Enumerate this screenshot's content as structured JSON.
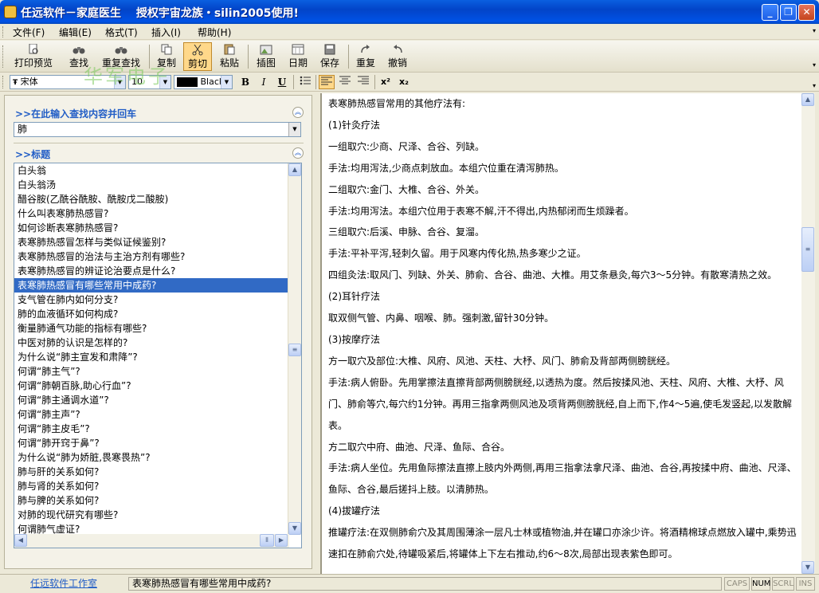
{
  "window": {
    "title": "任远软件－家庭医生　 授权宇宙龙族・silin2005使用!"
  },
  "menu": [
    "文件(F)",
    "编辑(E)",
    "格式(T)",
    "插入(I)",
    "帮助(H)"
  ],
  "toolbar": {
    "print_preview": "打印预览",
    "find": "查找",
    "find_again": "重复查找",
    "copy": "复制",
    "cut": "剪切",
    "paste": "粘贴",
    "insert_image": "插图",
    "date": "日期",
    "save": "保存",
    "redo": "重复",
    "undo": "撤销"
  },
  "format": {
    "font": "宋体",
    "size": "10",
    "color_name": "Black",
    "color_value": "#000000",
    "bold": "B",
    "italic": "I",
    "underline": "U",
    "superscript": "x²",
    "subscript": "x₂"
  },
  "watermark": "华军电子",
  "search": {
    "heading": ">>在此输入查找内容并回车",
    "value": "肺"
  },
  "titles": {
    "heading": ">>标题",
    "selected_index": 8,
    "items": [
      "白头翁",
      "白头翁汤",
      "醋谷胺(乙酰谷酰胺、酰胺戊二酸胺)",
      "什么叫表寒肺热感冒?",
      "如何诊断表寒肺热感冒?",
      "表寒肺热感冒怎样与类似证候鉴别?",
      "表寒肺热感冒的治法与主治方剂有哪些?",
      "表寒肺热感冒的辨证论治要点是什么?",
      "表寒肺热感冒有哪些常用中成药?",
      "支气管在肺内如何分支?",
      "肺的血液循环如何构成?",
      "衡量肺通气功能的指标有哪些?",
      "中医对肺的认识是怎样的?",
      "为什么说“肺主宣发和肃降”?",
      "何谓“肺主气”?",
      "何谓“肺朝百脉,助心行血”?",
      "何谓“肺主通调水道”?",
      "何谓“肺主声”?",
      "何谓“肺主皮毛”?",
      "何谓“肺开窍于鼻”?",
      "为什么说“肺为娇脏,畏寒畏热”?",
      "肺与肝的关系如何?",
      "肺与肾的关系如何?",
      "肺与脾的关系如何?",
      "对肺的现代研究有哪些?",
      "何谓肺气虚证?"
    ]
  },
  "content": [
    "表寒肺热感冒常用的其他疗法有:",
    "(1)针灸疗法",
    "一组取穴:少商、尺泽、合谷、列缺。",
    "手法:均用泻法,少商点刺放血。本组穴位重在清泻肺热。",
    "二组取穴:金门、大椎、合谷、外关。",
    "手法:均用泻法。本组穴位用于表寒不解,汗不得出,内热郁闭而生烦躁者。",
    "三组取穴:后溪、申脉、合谷、复溜。",
    "手法:平补平泻,轻刺久留。用于风寒内传化热,热多寒少之证。",
    "四组灸法:取风门、列缺、外关、肺俞、合谷、曲池、大椎。用艾条悬灸,每穴3～5分钟。有散寒清热之效。",
    "(2)耳针疗法",
    "取双侧气管、内鼻、咽喉、肺。强刺激,留针30分钟。",
    "(3)按摩疗法",
    "方一取穴及部位:大椎、风府、风池、天柱、大杼、风门、肺俞及背部两侧膀胱经。",
    "手法:病人俯卧。先用掌擦法直擦背部两侧膀胱经,以透热为度。然后按揉风池、天柱、风府、大椎、大杼、风门、肺俞等穴,每穴约1分钟。再用三指拿两侧风池及项背两侧膀胱经,自上而下,作4～5遍,使毛发竖起,以发散解表。",
    "方二取穴中府、曲池、尺泽、鱼际、合谷。",
    "手法:病人坐位。先用鱼际擦法直擦上肢内外两侧,再用三指拿法拿尺泽、曲池、合谷,再按揉中府、曲池、尺泽、鱼际、合谷,最后搓抖上肢。以清肺热。",
    "(4)拔罐疗法",
    "推罐疗法:在双侧肺俞穴及其周围薄涂一层凡士林或植物油,并在罐口亦涂少许。将酒精棉球点燃放入罐中,乘势迅速扣在肺俞穴处,待罐吸紧后,将罐体上下左右推动,约6～8次,局部出现表紫色即可。"
  ],
  "status": {
    "link": "任远软件工作室",
    "message": "表寒肺热感冒有哪些常用中成药?",
    "caps": "CAPS",
    "num": "NUM",
    "scrl": "SCRL",
    "ins": "INS"
  }
}
